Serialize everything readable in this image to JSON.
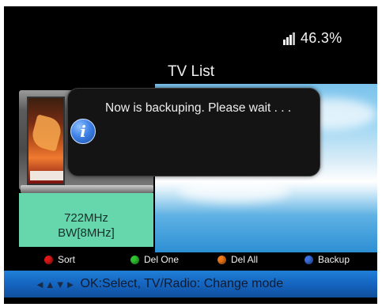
{
  "status": {
    "signal_value": "46.3%",
    "signal_icon": "signal-strength-icon"
  },
  "page": {
    "title": "TV List"
  },
  "dialog": {
    "message": "Now is backuping. Please wait . . .",
    "icon": "info-icon",
    "icon_glyph": "i"
  },
  "channel_info": {
    "frequency": "722MHz",
    "bandwidth": "BW[8MHz]"
  },
  "legend": [
    {
      "color": "#e01818",
      "label": "Sort"
    },
    {
      "color": "#2fc52f",
      "label": "Del One"
    },
    {
      "color": "#f07818",
      "label": "Del All"
    },
    {
      "color": "#3a6fe0",
      "label": "Backup"
    }
  ],
  "help_bar": {
    "arrows": "◄▲▼►",
    "text": "OK:Select, TV/Radio: Change mode"
  },
  "colors": {
    "help_bar": "#1565c0",
    "info_panel": "#66d6ac",
    "dialog_bg": "#141414"
  }
}
